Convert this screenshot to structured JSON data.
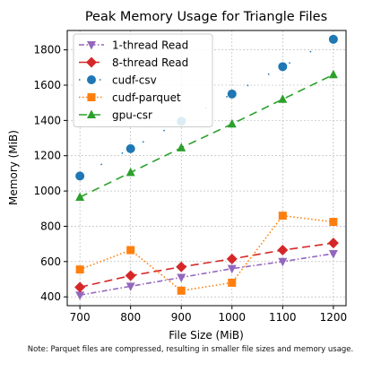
{
  "chart_data": {
    "type": "line",
    "title": "Peak Memory Usage for Triangle Files",
    "xlabel": "File Size (MiB)",
    "ylabel": "Memory (MiB)",
    "x": [
      700,
      800,
      900,
      1000,
      1100,
      1200
    ],
    "xlim": [
      675,
      1225
    ],
    "ylim": [
      350,
      1910
    ],
    "xticks": [
      700,
      800,
      900,
      1000,
      1100,
      1200
    ],
    "yticks": [
      400,
      600,
      800,
      1000,
      1200,
      1400,
      1600,
      1800
    ],
    "grid": true,
    "legend_position": "upper-left",
    "series": [
      {
        "name": "1-thread Read",
        "values": [
          410,
          460,
          510,
          560,
          600,
          645
        ],
        "color": "#9467bd",
        "linestyle": "dashdot",
        "marker": "triangle-down"
      },
      {
        "name": "8-thread Read",
        "values": [
          455,
          520,
          570,
          615,
          665,
          705
        ],
        "color": "#d62728",
        "linestyle": "longdash",
        "marker": "diamond"
      },
      {
        "name": "cudf-csv",
        "values": [
          1085,
          1240,
          1395,
          1550,
          1705,
          1860
        ],
        "color": "#1f77b4",
        "linestyle": "dotted-sparse",
        "marker": "circle"
      },
      {
        "name": "cudf-parquet",
        "values": [
          555,
          665,
          435,
          480,
          860,
          825
        ],
        "color": "#ff7f0e",
        "linestyle": "dotted",
        "marker": "square"
      },
      {
        "name": "gpu-csr",
        "values": [
          965,
          1105,
          1245,
          1380,
          1520,
          1660
        ],
        "color": "#2ca02c",
        "linestyle": "dashed",
        "marker": "triangle-up"
      }
    ]
  },
  "footnote": "Note: Parquet files are compressed, resulting in smaller file sizes and memory usage."
}
